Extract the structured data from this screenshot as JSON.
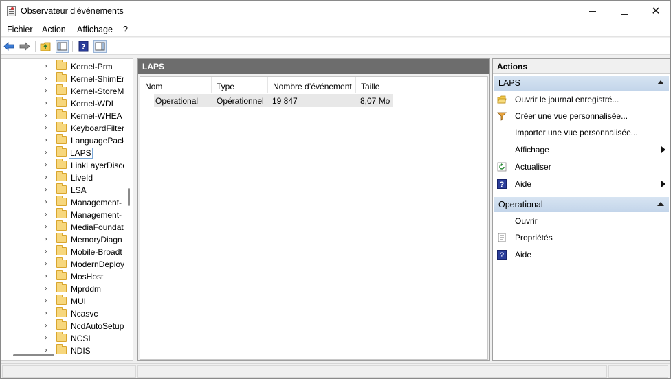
{
  "window": {
    "title": "Observateur d'événements"
  },
  "menu": {
    "file": "Fichier",
    "action": "Action",
    "view": "Affichage",
    "help": "?"
  },
  "tree": {
    "items": [
      {
        "label": "Kernel-Prm"
      },
      {
        "label": "Kernel-ShimEr"
      },
      {
        "label": "Kernel-StoreM"
      },
      {
        "label": "Kernel-WDI"
      },
      {
        "label": "Kernel-WHEA"
      },
      {
        "label": "KeyboardFilter"
      },
      {
        "label": "LanguagePack"
      },
      {
        "label": "LAPS",
        "selected": true
      },
      {
        "label": "LinkLayerDisco"
      },
      {
        "label": "LiveId"
      },
      {
        "label": "LSA"
      },
      {
        "label": "Management-"
      },
      {
        "label": "Management-"
      },
      {
        "label": "MediaFoundat"
      },
      {
        "label": "MemoryDiagn"
      },
      {
        "label": "Mobile-Broadt"
      },
      {
        "label": "ModernDeploy"
      },
      {
        "label": "MosHost"
      },
      {
        "label": "Mprddm"
      },
      {
        "label": "MUI"
      },
      {
        "label": "Ncasvc"
      },
      {
        "label": "NcdAutoSetup"
      },
      {
        "label": "NCSI"
      },
      {
        "label": "NDIS"
      }
    ]
  },
  "center": {
    "title": "LAPS",
    "columns": {
      "name": "Nom",
      "type": "Type",
      "count": "Nombre d’événement",
      "size": "Taille"
    },
    "rows": [
      {
        "name": "Operational",
        "type": "Opérationnel",
        "count": "19 847",
        "size": "8,07 Mo"
      }
    ]
  },
  "actions": {
    "title": "Actions",
    "section1": {
      "title": "LAPS",
      "items": [
        {
          "label": "Ouvrir le journal enregistré...",
          "icon": "folder-open-icon"
        },
        {
          "label": "Créer une vue personnalisée...",
          "icon": "filter-icon"
        },
        {
          "label": "Importer une vue personnalisée...",
          "icon": ""
        },
        {
          "label": "Affichage",
          "icon": "",
          "submenu": true
        },
        {
          "label": "Actualiser",
          "icon": "refresh-icon"
        },
        {
          "label": "Aide",
          "icon": "help-icon",
          "submenu": true
        }
      ]
    },
    "section2": {
      "title": "Operational",
      "items": [
        {
          "label": "Ouvrir",
          "icon": ""
        },
        {
          "label": "Propriétés",
          "icon": "properties-icon"
        },
        {
          "label": "Aide",
          "icon": "help-icon"
        }
      ]
    }
  },
  "colors": {
    "center_header_bg": "#6d6d6d",
    "section_header_bg": "#c8d9ec",
    "selection_outline": "#7aa7d6"
  }
}
